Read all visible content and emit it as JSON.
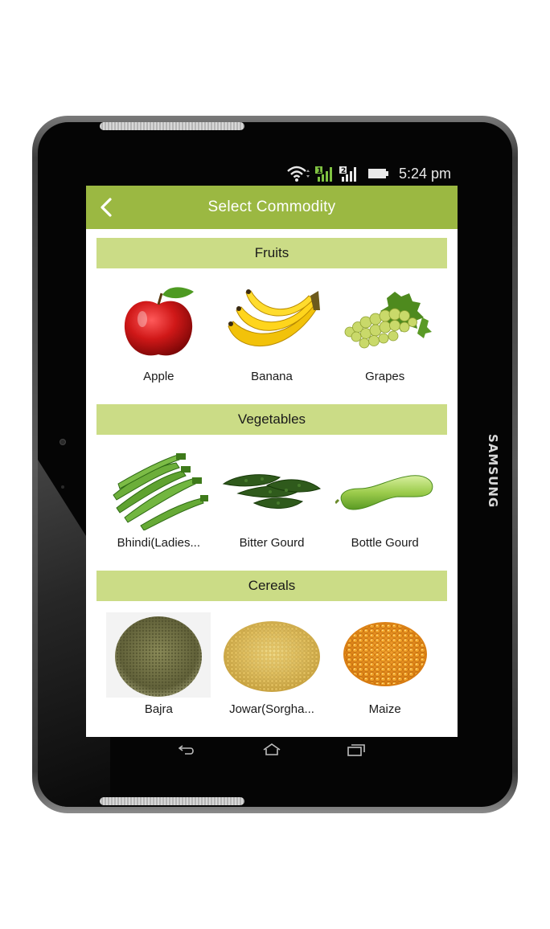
{
  "device": {
    "brand": "SAMSUNG"
  },
  "status_bar": {
    "time": "5:24 pm",
    "sim1": "1",
    "sim2": "2",
    "icons": [
      "wifi-icon",
      "signal-icon",
      "signal-icon",
      "battery-icon"
    ]
  },
  "app_bar": {
    "title": "Select Commodity",
    "back_icon": "back-arrow-icon"
  },
  "sections": [
    {
      "title": "Fruits",
      "items": [
        {
          "label": "Apple",
          "icon": "apple-image"
        },
        {
          "label": "Banana",
          "icon": "banana-image"
        },
        {
          "label": "Grapes",
          "icon": "grapes-image"
        }
      ]
    },
    {
      "title": "Vegetables",
      "items": [
        {
          "label": "Bhindi(Ladies...",
          "icon": "okra-image"
        },
        {
          "label": "Bitter Gourd",
          "icon": "bitter-gourd-image"
        },
        {
          "label": "Bottle Gourd",
          "icon": "bottle-gourd-image"
        }
      ]
    },
    {
      "title": "Cereals",
      "items": [
        {
          "label": "Bajra",
          "icon": "bajra-image"
        },
        {
          "label": "Jowar(Sorgha...",
          "icon": "jowar-image"
        },
        {
          "label": "Maize",
          "icon": "maize-image"
        }
      ]
    }
  ],
  "nav_bar": {
    "icons": [
      "back-icon",
      "home-icon",
      "recent-apps-icon"
    ]
  },
  "colors": {
    "app_bar": "#9bb842",
    "section_header": "#cbdc86"
  }
}
